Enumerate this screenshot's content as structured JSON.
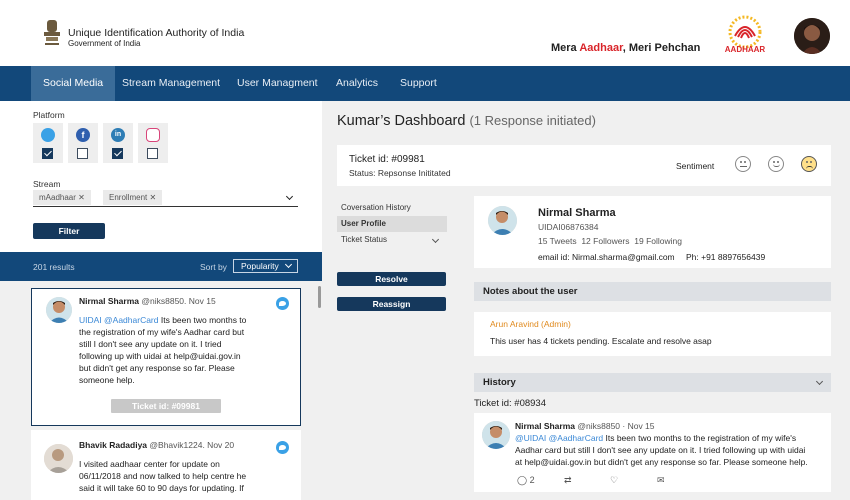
{
  "header": {
    "org_name": "Unique Identification Authority of India",
    "org_sub": "Government of India",
    "slogan_prefix": "Mera ",
    "slogan_red": "Aadhaar",
    "slogan_suffix": ", Meri Pehchan",
    "logo_text": "AADHAAR",
    "brand_red": "#d9252a",
    "brand_yellow": "#f4b823"
  },
  "nav": {
    "items": [
      "Social Media",
      "Stream Management",
      "User Managment",
      "Analytics",
      "Support"
    ],
    "active": "Social Media",
    "color": "#12487a"
  },
  "filters": {
    "platform_label": "Platform",
    "platforms": [
      {
        "name": "twitter",
        "icon": "twitter-icon",
        "checked": true,
        "color": "#3aa1e6"
      },
      {
        "name": "facebook",
        "icon": "facebook-icon",
        "checked": false,
        "color": "#2f5fae"
      },
      {
        "name": "linkedin",
        "icon": "linkedin-icon",
        "checked": true,
        "color": "#2e7db5"
      },
      {
        "name": "instagram",
        "icon": "instagram-icon",
        "checked": false,
        "color": "#d8457a"
      }
    ],
    "stream_label": "Stream",
    "stream_chips": [
      "mAadhaar",
      "Enrollment"
    ],
    "filter_button": "Filter"
  },
  "results": {
    "count_text": "201 results",
    "sort_label": "Sort by",
    "sort_value": "Popularity"
  },
  "feed": [
    {
      "name": "Nirmal Sharma",
      "handle_date": "@niks8850. Nov 15",
      "mention": "UIDAI @AadharCard",
      "text_lines": [
        "Its been two months to",
        "the registration of my wife's Aadhar card but",
        "still I don't see any update on it. I tried",
        "following up with uidai at help@uidai.gov.in",
        "but didn't get any response so far. Please",
        "someone help."
      ],
      "ticket": "Ticket id: #09981"
    },
    {
      "name": "Bhavik Radadiya",
      "handle_date": "@Bhavik1224. Nov 20",
      "text_lines": [
        "I visited aadhaar center for update on",
        "06/11/2018 and now talked to help centre he",
        "said it will take 60 to 90 days for updating. If"
      ]
    }
  ],
  "dashboard": {
    "title": "Kumar’s Dashboard",
    "subtitle": "(1 Response initiated)",
    "ticket_id": "Ticket id: #09981",
    "status": "Status: Repsonse Inititated",
    "sentiment_label": "Sentiment",
    "sentiment_selected": "negative"
  },
  "side_menu": {
    "items": [
      "Coversation History",
      "User Profile",
      "Ticket Status"
    ],
    "active": "User Profile",
    "resolve": "Resolve",
    "reassign": "Reassign"
  },
  "profile": {
    "name": "Nirmal Sharma",
    "uid": "UIDAI06876384",
    "tweets": "15 Tweets",
    "followers": "12 Followers",
    "following": "19 Following",
    "email": "email id: Nirmal.sharma@gmail.com",
    "phone": "Ph: +91 8897656439"
  },
  "notes": {
    "header": "Notes about the user",
    "author": "Arun Aravind (Admin)",
    "text": "This user has 4 tickets pending. Escalate and resolve asap",
    "author_color": "#e08a1e"
  },
  "history": {
    "header": "History",
    "ticket_id": "Ticket id: #08934",
    "tweet": {
      "name": "Nirmal Sharma",
      "handle_date": "@niks8850 · Nov 15",
      "mention": "@UIDAI @AadharCard",
      "line1_rest": "Its been two months to the registration of my wife's",
      "line2": "Aadhar card but still I don't see any update on it. I tried following up with uidai",
      "line3": "at help@uidai.gov.in but didn't get any response so far. Please someone help.",
      "reply_count": "2"
    }
  }
}
